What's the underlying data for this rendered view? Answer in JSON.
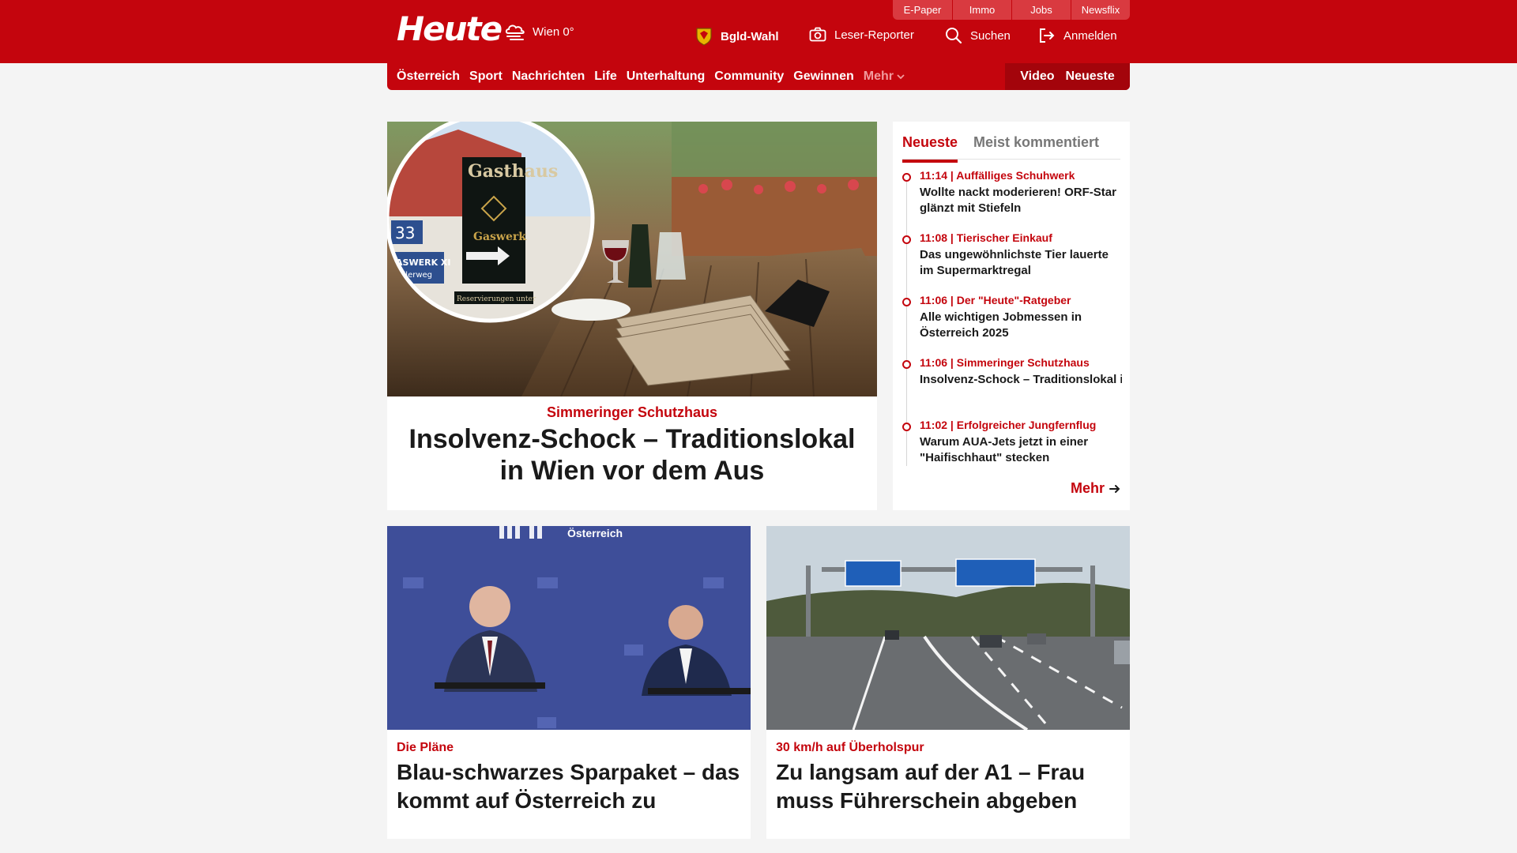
{
  "header": {
    "logo": "Heute",
    "weather": "Wien 0°",
    "utility": [
      "E-Paper",
      "Immo",
      "Jobs",
      "Newsflix"
    ],
    "nav": {
      "bgld_wahl": "Bgld-Wahl",
      "leser_reporter": "Leser-Reporter",
      "suchen": "Suchen",
      "anmelden": "Anmelden"
    }
  },
  "mainnav": {
    "items": [
      "Österreich",
      "Sport",
      "Nachrichten",
      "Life",
      "Unterhaltung",
      "Community",
      "Gewinnen"
    ],
    "more": "Mehr",
    "video": "Video",
    "neueste": "Neueste"
  },
  "hero": {
    "kicker": "Simmeringer Schutzhaus",
    "title": "Insolvenz-Schock – Traditionslokal in Wien vor dem Aus",
    "image_sign": {
      "gasthaus": "Gasthaus",
      "gaswerk": "Gaswerk",
      "house_number": "33",
      "street": "GASWERK XI",
      "street2": "Gillerweg",
      "reservations": "Reservierungen unter"
    }
  },
  "sidebar": {
    "tab_active": "Neueste",
    "tab_other": "Meist kommentiert",
    "items": [
      {
        "meta": "11:14 | Auffälliges Schuhwerk",
        "text": "Wollte nackt moderieren! ORF-Star glänzt mit Stiefeln"
      },
      {
        "meta": "11:08 | Tierischer Einkauf",
        "text": "Das ungewöhnlichste Tier lauerte im Supermarktregal"
      },
      {
        "meta": "11:06 | Der \"Heute\"-Ratgeber",
        "text": "Alle wichtigen Jobmessen in Österreich 2025"
      },
      {
        "meta": "11:06 | Simmeringer Schutzhaus",
        "text": "Insolvenz-Schock – Traditionslokal in Wien vor dem..."
      },
      {
        "meta": "11:02 | Erfolgreicher Jungfernflug",
        "text": "Warum AUA-Jets jetzt in einer \"Haifischhaut\" stecken"
      }
    ],
    "more": "Mehr"
  },
  "cards": [
    {
      "kicker": "Die Pläne",
      "title": "Blau-schwarzes Sparpaket – das kommt auf Österreich zu",
      "image_caption": "Österreich"
    },
    {
      "kicker": "30 km/h auf Überholspur",
      "title": "Zu langsam auf der A1 – Frau muss Führerschein abgeben"
    }
  ],
  "colors": {
    "brand_red": "#c4050d",
    "background": "#f4f4f4"
  }
}
